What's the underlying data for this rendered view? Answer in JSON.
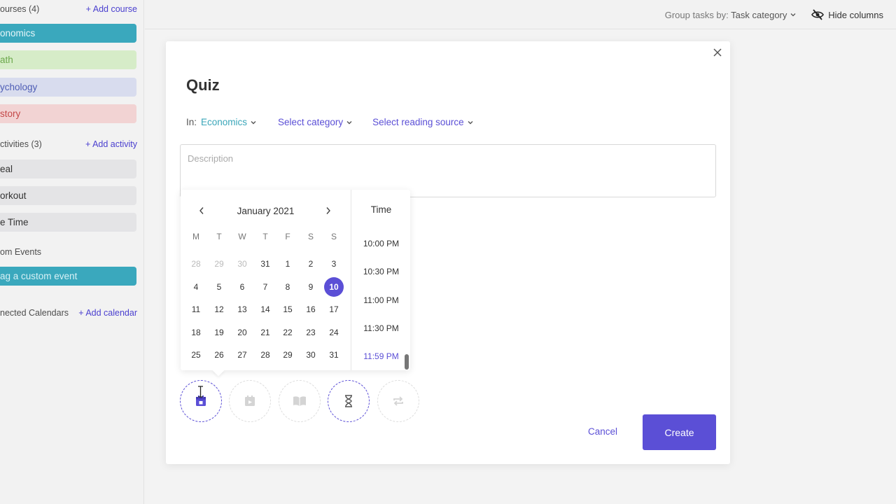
{
  "sidebar": {
    "courses_header": "ourses (4)",
    "add_course": "+ Add course",
    "courses": [
      {
        "label": "onomics",
        "bg": "#3aa8bd",
        "fg": "#e6f6f9"
      },
      {
        "label": "ath",
        "bg": "#d6ecc8",
        "fg": "#6ba84a"
      },
      {
        "label": "ychology",
        "bg": "#d8dcee",
        "fg": "#4e5db5"
      },
      {
        "label": "story",
        "bg": "#f2d3d3",
        "fg": "#c44848"
      }
    ],
    "activities_header": "ctivities (3)",
    "add_activity": "+ Add activity",
    "activities": [
      {
        "label": "eal"
      },
      {
        "label": "orkout"
      },
      {
        "label": "e Time"
      }
    ],
    "custom_events_header": "om Events",
    "custom_event_placeholder": "ag a custom event",
    "calendars_header": "nected Calendars",
    "add_calendar": "+ Add calendar"
  },
  "topbar": {
    "group_by_label": "Group tasks by:",
    "group_by_value": "Task category",
    "hide_columns": "Hide columns"
  },
  "modal": {
    "title": "Quiz",
    "in_label": "In:",
    "course_value": "Economics",
    "category_select": "Select category",
    "reading_source_select": "Select reading source",
    "description_placeholder": "Description",
    "cancel": "Cancel",
    "create": "Create"
  },
  "datepicker": {
    "month": "January 2021",
    "weekdays": [
      "M",
      "T",
      "W",
      "T",
      "F",
      "S",
      "S"
    ],
    "weeks": [
      [
        {
          "d": "28",
          "o": true
        },
        {
          "d": "29",
          "o": true
        },
        {
          "d": "30",
          "o": true
        },
        {
          "d": "31"
        },
        {
          "d": "1"
        },
        {
          "d": "2"
        },
        {
          "d": "3"
        }
      ],
      [
        {
          "d": "4"
        },
        {
          "d": "5"
        },
        {
          "d": "6"
        },
        {
          "d": "7"
        },
        {
          "d": "8"
        },
        {
          "d": "9"
        },
        {
          "d": "10",
          "sel": true
        }
      ],
      [
        {
          "d": "11"
        },
        {
          "d": "12"
        },
        {
          "d": "13"
        },
        {
          "d": "14"
        },
        {
          "d": "15"
        },
        {
          "d": "16"
        },
        {
          "d": "17"
        }
      ],
      [
        {
          "d": "18"
        },
        {
          "d": "19"
        },
        {
          "d": "20"
        },
        {
          "d": "21"
        },
        {
          "d": "22"
        },
        {
          "d": "23"
        },
        {
          "d": "24"
        }
      ],
      [
        {
          "d": "25"
        },
        {
          "d": "26"
        },
        {
          "d": "27"
        },
        {
          "d": "28"
        },
        {
          "d": "29"
        },
        {
          "d": "30"
        },
        {
          "d": "31"
        }
      ]
    ],
    "selected_day": "10",
    "time_header": "Time",
    "times": [
      "10:00 PM",
      "10:30 PM",
      "11:00 PM",
      "11:30 PM",
      "11:59 PM"
    ],
    "selected_time": "11:59 PM"
  },
  "action_icons": [
    {
      "name": "due-date-icon",
      "active": true
    },
    {
      "name": "start-date-icon",
      "active": false
    },
    {
      "name": "reading-icon",
      "active": false
    },
    {
      "name": "duration-icon",
      "active": true
    },
    {
      "name": "repeat-icon",
      "active": false
    }
  ],
  "colors": {
    "accent": "#5b4fd6",
    "teal": "#3aa6b9"
  }
}
